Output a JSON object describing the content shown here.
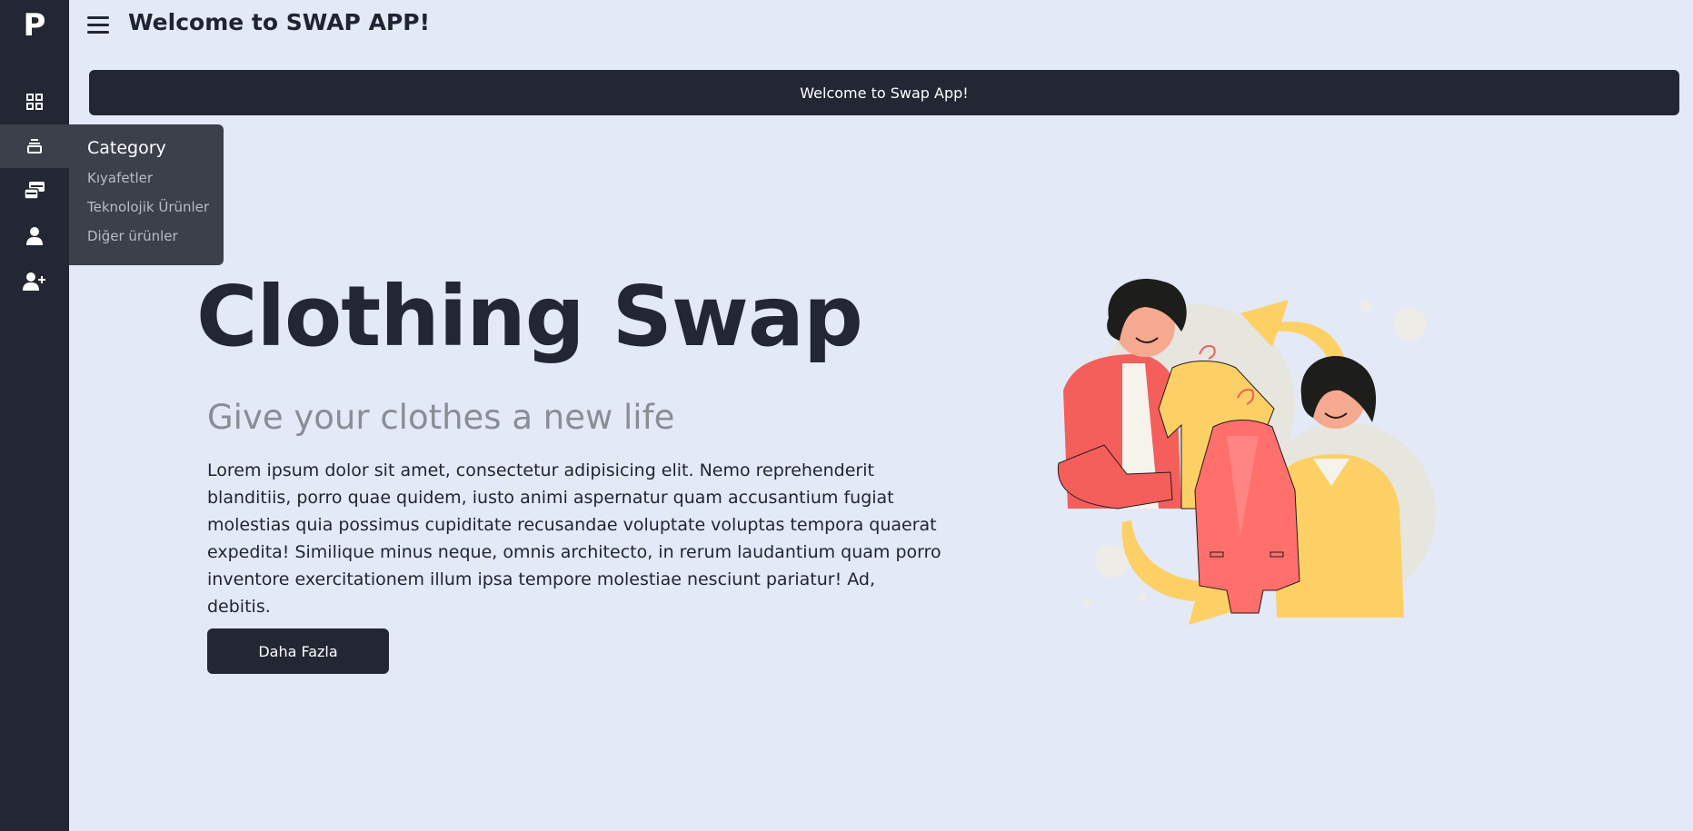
{
  "sidebar": {
    "logo": "P",
    "items": [
      {
        "name": "dashboard-grid-icon"
      },
      {
        "name": "category-stack-icon"
      },
      {
        "name": "swap-cards-icon"
      },
      {
        "name": "user-icon"
      },
      {
        "name": "user-add-icon"
      }
    ],
    "flyout": {
      "title": "Category",
      "items": [
        "Kıyafetler",
        "Teknolojik Ürünler",
        "Diğer ürünler"
      ]
    }
  },
  "header": {
    "menu_icon": "hamburger-menu-icon",
    "title": "Welcome to SWAP APP!"
  },
  "banner": {
    "text": "Welcome to Swap App!"
  },
  "hero": {
    "title": "Clothing Swap",
    "subtitle": "Give your clothes a new life",
    "body": "Lorem ipsum dolor sit amet, consectetur adipisicing elit. Nemo reprehenderit blanditiis, porro quae quidem, iusto animi aspernatur quam accusantium fugiat molestias quia possimus cupiditate recusandae voluptate voluptas tempora quaerat expedita! Similique minus neque, omnis architecto, in rerum laudantium quam porro inventore exercitationem illum ipsa tempore molestiae nesciunt pariatur! Ad, debitis.",
    "button": "Daha Fazla"
  },
  "colors": {
    "sidebar": "#222733",
    "background": "#e4e9f7",
    "accent_yellow": "#fdd066",
    "accent_coral": "#f45f5b"
  }
}
